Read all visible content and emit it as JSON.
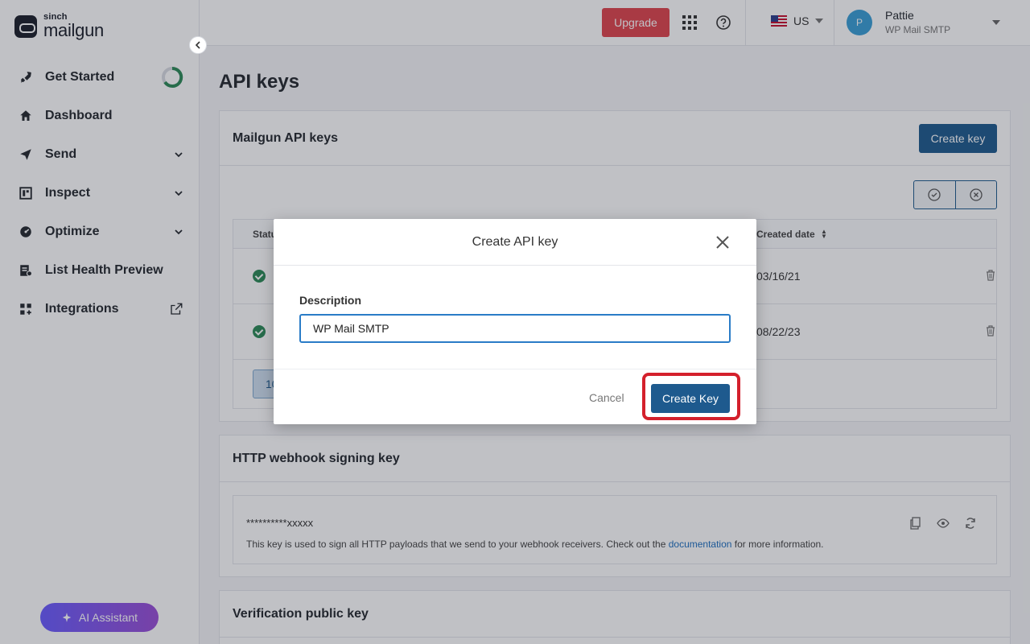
{
  "brand": {
    "sub": "sinch",
    "name": "mailgun"
  },
  "nav": {
    "items": [
      {
        "label": "Get Started",
        "icon": "rocket-icon"
      },
      {
        "label": "Dashboard",
        "icon": "home-icon"
      },
      {
        "label": "Send",
        "icon": "send-icon",
        "expandable": true
      },
      {
        "label": "Inspect",
        "icon": "inspect-icon",
        "expandable": true
      },
      {
        "label": "Optimize",
        "icon": "optimize-icon",
        "expandable": true
      },
      {
        "label": "List Health Preview",
        "icon": "list-health-icon"
      },
      {
        "label": "Integrations",
        "icon": "integrations-icon",
        "external": true
      }
    ]
  },
  "ai_assistant": {
    "label": "AI Assistant"
  },
  "topbar": {
    "upgrade_label": "Upgrade",
    "region": "US",
    "user": {
      "initial": "P",
      "name": "Pattie",
      "account": "WP Mail SMTP"
    }
  },
  "page": {
    "title": "API keys"
  },
  "api_keys_card": {
    "title": "Mailgun API keys",
    "create_label": "Create key",
    "table": {
      "headers": {
        "status": "Status",
        "created": "Created date"
      },
      "rows": [
        {
          "created": "03/16/21"
        },
        {
          "created": "08/22/23"
        }
      ],
      "pager": "10"
    }
  },
  "webhook_card": {
    "title": "HTTP webhook signing key",
    "masked_key": "**********xxxxx",
    "description_before": "This key is used to sign all HTTP payloads that we send to your webhook receivers. Check out the ",
    "link_text": "documentation",
    "description_after": " for more information."
  },
  "verification_card": {
    "title": "Verification public key"
  },
  "modal": {
    "title": "Create API key",
    "field_label": "Description",
    "field_value": "WP Mail SMTP",
    "cancel_label": "Cancel",
    "submit_label": "Create Key"
  },
  "colors": {
    "primary": "#1e5a8e",
    "upgrade": "#e0454d",
    "highlight": "#d4202c",
    "status_active": "#2c8a57"
  }
}
